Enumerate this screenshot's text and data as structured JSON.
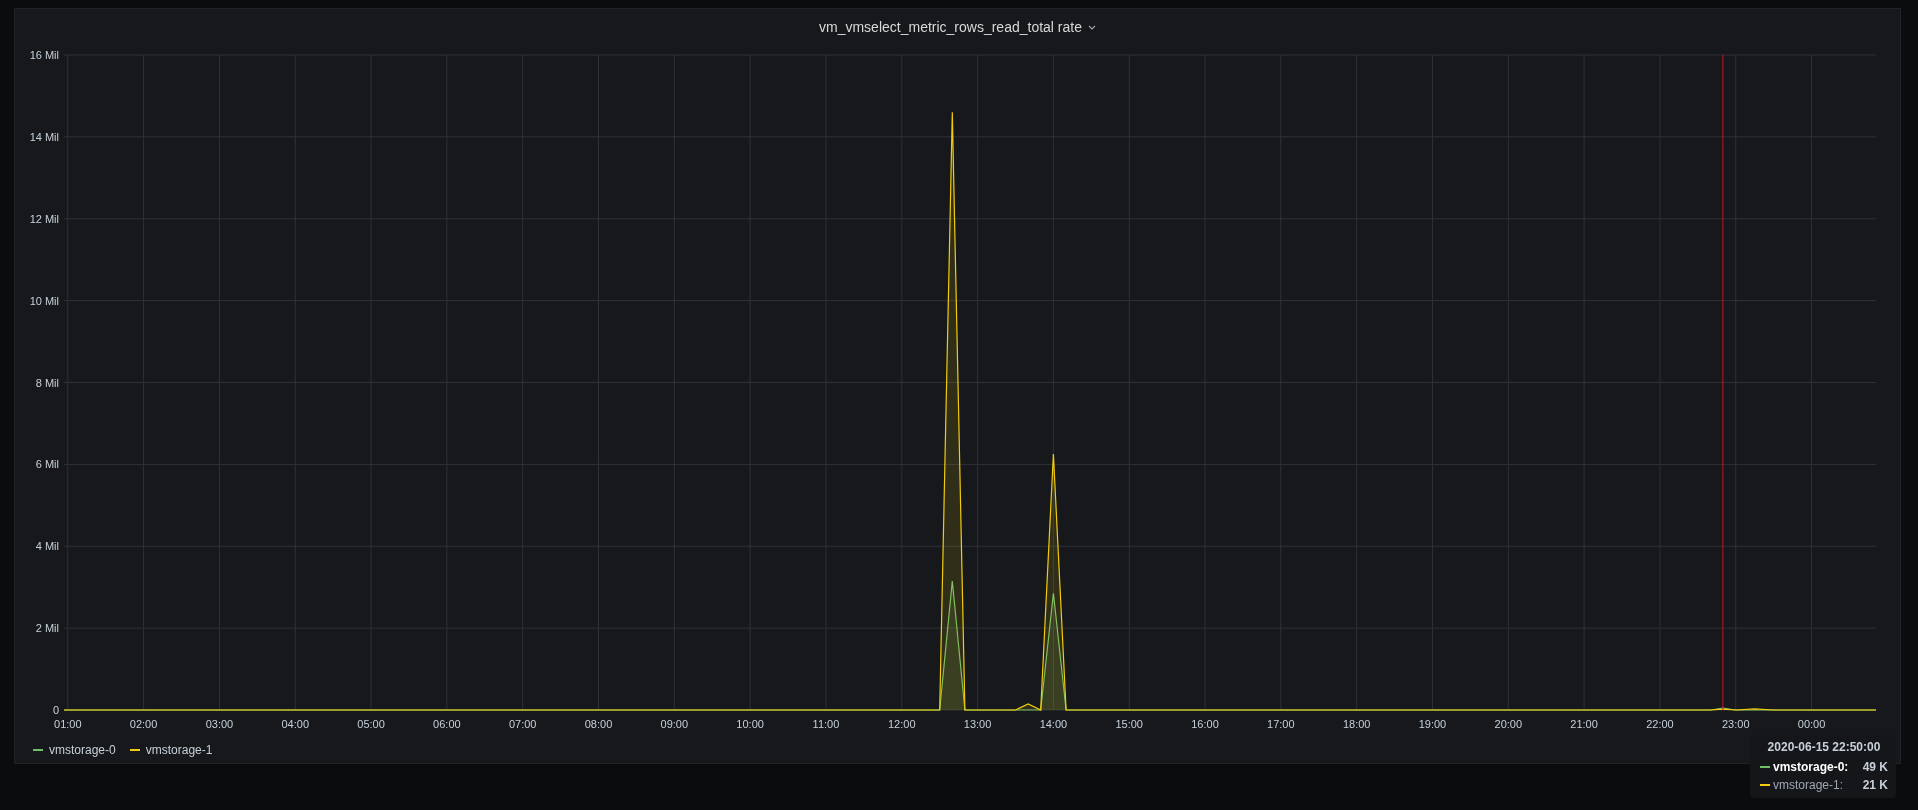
{
  "panel": {
    "title": "vm_vmselect_metric_rows_read_total rate",
    "chart_data": {
      "type": "area",
      "x": [
        0.95,
        12.5,
        12.667,
        12.833,
        13.5,
        13.667,
        13.833,
        14.0,
        14.167,
        22.667,
        22.833,
        23.0,
        23.25,
        23.5,
        24.85
      ],
      "series": [
        {
          "name": "vmstorage-0",
          "color": "#73bf69",
          "values": [
            0,
            0,
            3.15,
            0,
            0,
            0,
            0,
            2.85,
            0,
            0,
            0.05,
            0,
            0,
            0,
            0
          ]
        },
        {
          "name": "vmstorage-1",
          "color": "#f2cc0c",
          "values": [
            0,
            0,
            14.6,
            0,
            0,
            0.15,
            0,
            6.25,
            0,
            0,
            0.02,
            0,
            0.03,
            0,
            0
          ]
        }
      ],
      "grid": true,
      "xlim": [
        0.95,
        24.85
      ],
      "ylim": [
        0,
        16
      ],
      "xticks": [
        {
          "value": 1,
          "label": "01:00"
        },
        {
          "value": 2,
          "label": "02:00"
        },
        {
          "value": 3,
          "label": "03:00"
        },
        {
          "value": 4,
          "label": "04:00"
        },
        {
          "value": 5,
          "label": "05:00"
        },
        {
          "value": 6,
          "label": "06:00"
        },
        {
          "value": 7,
          "label": "07:00"
        },
        {
          "value": 8,
          "label": "08:00"
        },
        {
          "value": 9,
          "label": "09:00"
        },
        {
          "value": 10,
          "label": "10:00"
        },
        {
          "value": 11,
          "label": "11:00"
        },
        {
          "value": 12,
          "label": "12:00"
        },
        {
          "value": 13,
          "label": "13:00"
        },
        {
          "value": 14,
          "label": "14:00"
        },
        {
          "value": 15,
          "label": "15:00"
        },
        {
          "value": 16,
          "label": "16:00"
        },
        {
          "value": 17,
          "label": "17:00"
        },
        {
          "value": 18,
          "label": "18:00"
        },
        {
          "value": 19,
          "label": "19:00"
        },
        {
          "value": 20,
          "label": "20:00"
        },
        {
          "value": 21,
          "label": "21:00"
        },
        {
          "value": 22,
          "label": "22:00"
        },
        {
          "value": 23,
          "label": "23:00"
        },
        {
          "value": 24,
          "label": "00:00"
        }
      ],
      "yticks": [
        {
          "value": 0,
          "label": "0"
        },
        {
          "value": 2,
          "label": "2 Mil"
        },
        {
          "value": 4,
          "label": "4 Mil"
        },
        {
          "value": 6,
          "label": "6 Mil"
        },
        {
          "value": 8,
          "label": "8 Mil"
        },
        {
          "value": 10,
          "label": "10 Mil"
        },
        {
          "value": 12,
          "label": "12 Mil"
        },
        {
          "value": 14,
          "label": "14 Mil"
        },
        {
          "value": 16,
          "label": "16 Mil"
        }
      ],
      "ref_lines": [
        {
          "axis": "x",
          "value": 22.83,
          "color": "#c4162a"
        }
      ]
    }
  },
  "tooltip": {
    "time": "2020-06-15 22:50:00",
    "rows": [
      {
        "name": "vmstorage-0:",
        "value": "49 K",
        "color": "#73bf69",
        "selected": true
      },
      {
        "name": "vmstorage-1:",
        "value": "21 K",
        "color": "#f2cc0c",
        "selected": false
      }
    ]
  }
}
